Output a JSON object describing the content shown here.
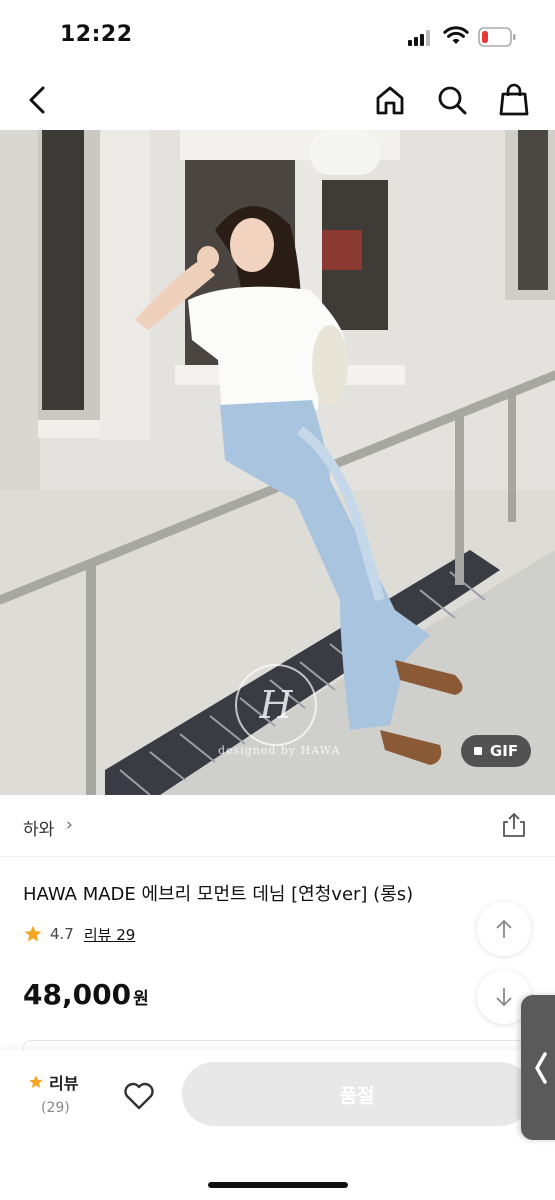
{
  "status_bar": {
    "time": "12:22",
    "signal_icon": "cellular-signal-icon",
    "wifi_icon": "wifi-icon",
    "battery_icon": "battery-low-icon",
    "battery_color": "#e53935"
  },
  "nav": {
    "back_icon": "back-chevron-icon",
    "home_icon": "home-icon",
    "search_icon": "search-icon",
    "cart_icon": "shopping-bag-icon"
  },
  "hero": {
    "watermark_caption": "designed by HAWA",
    "gif_badge_label": "GIF"
  },
  "brand": {
    "name": "하와",
    "chevron": "›",
    "share_icon": "share-icon"
  },
  "product": {
    "title": "HAWA MADE 에브리 모먼트 데님 [연청ver] (롱s)",
    "rating": "4.7",
    "review_link": "리뷰 29",
    "price": "48,000",
    "currency_unit": "원",
    "accent_star_color": "#f5a623"
  },
  "bottom_bar": {
    "review_label": "리뷰",
    "review_count": "(29)",
    "wishlist_icon": "heart-outline-icon",
    "buy_button_label": "품절",
    "buy_button_bg": "#e8e8e8"
  },
  "side_handle_icon": "chevron-left-icon"
}
